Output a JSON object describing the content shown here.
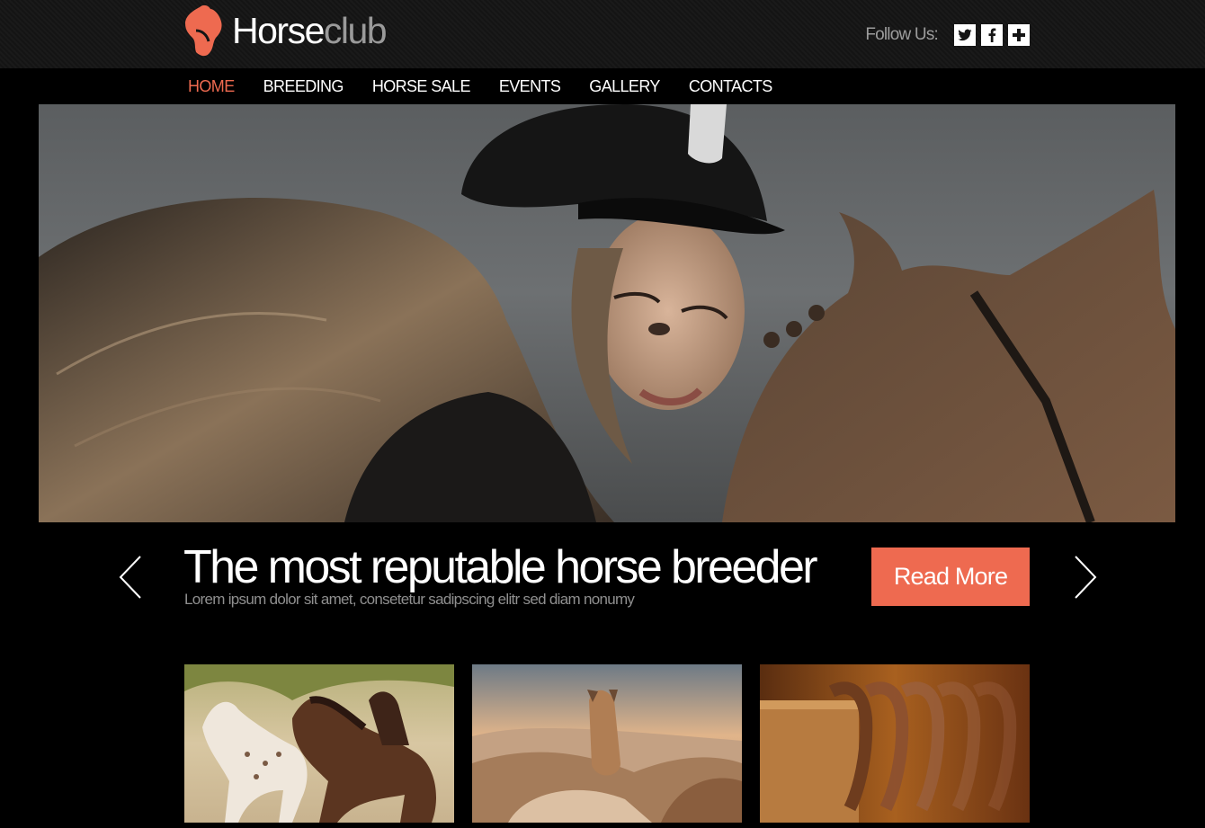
{
  "brand": {
    "name_primary": "Horse",
    "name_secondary": "club",
    "accent_color": "#ee6a50"
  },
  "follow": {
    "label": "Follow Us:",
    "icons": [
      "twitter-icon",
      "facebook-icon",
      "plus-icon"
    ]
  },
  "nav": {
    "items": [
      "HOME",
      "BREEDING",
      "HORSE SALE",
      "EVENTS",
      "GALLERY",
      "CONTACTS"
    ],
    "active": "HOME"
  },
  "slide": {
    "title": "The most reputable horse breeder",
    "subtitle": "Lorem ipsum dolor sit amet, consetetur sadipscing elitr sed diam nonumy",
    "button_label": "Read More"
  },
  "thumbnails": [
    "horses-running-photo",
    "horse-herd-sunset-photo",
    "horseshoes-photo"
  ]
}
